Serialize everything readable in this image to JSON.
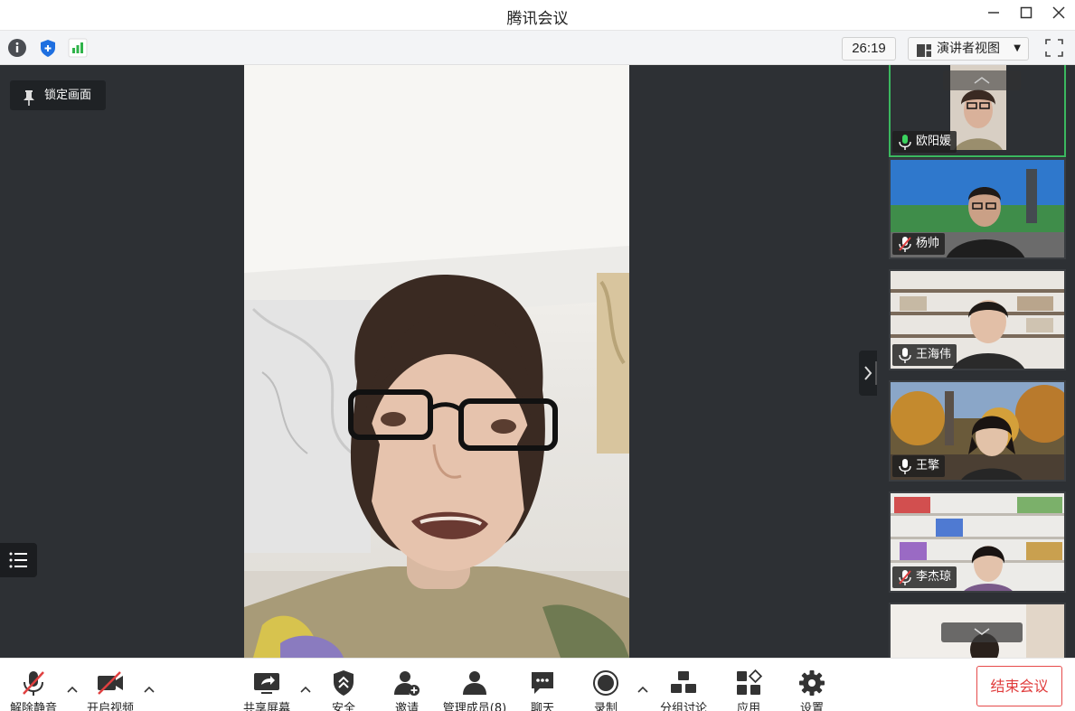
{
  "window": {
    "title": "腾讯会议",
    "minimize_icon": "minimize-icon",
    "maximize_icon": "maximize-icon",
    "close_icon": "close-icon"
  },
  "infobar": {
    "timer": "26:19",
    "view_mode": "演讲者视图",
    "icons": [
      "info-icon",
      "shield-icon",
      "signal-icon",
      "fullscreen-icon"
    ]
  },
  "stage": {
    "lock_label": "锁定画面"
  },
  "participants": [
    {
      "name": "欧阳媛",
      "mic": "on",
      "active": true
    },
    {
      "name": "杨帅",
      "mic": "muted",
      "active": false
    },
    {
      "name": "王海伟",
      "mic": "on",
      "active": false
    },
    {
      "name": "王擎",
      "mic": "on",
      "active": false
    },
    {
      "name": "李杰琼",
      "mic": "muted",
      "active": false
    },
    {
      "name": "",
      "mic": "",
      "active": false
    }
  ],
  "toolbar": {
    "unmute": "解除静音",
    "start_video": "开启视频",
    "share_screen": "共享屏幕",
    "security": "安全",
    "invite": "邀请",
    "manage_members": "管理成员(8)",
    "chat": "聊天",
    "record": "录制",
    "breakout": "分组讨论",
    "apps": "应用",
    "settings": "设置",
    "end_meeting": "结束会议"
  },
  "colors": {
    "stage_bg": "#2d3034",
    "active_border": "#3bb85f",
    "end_button": "#e03c3c",
    "muted_red": "#e04040"
  }
}
